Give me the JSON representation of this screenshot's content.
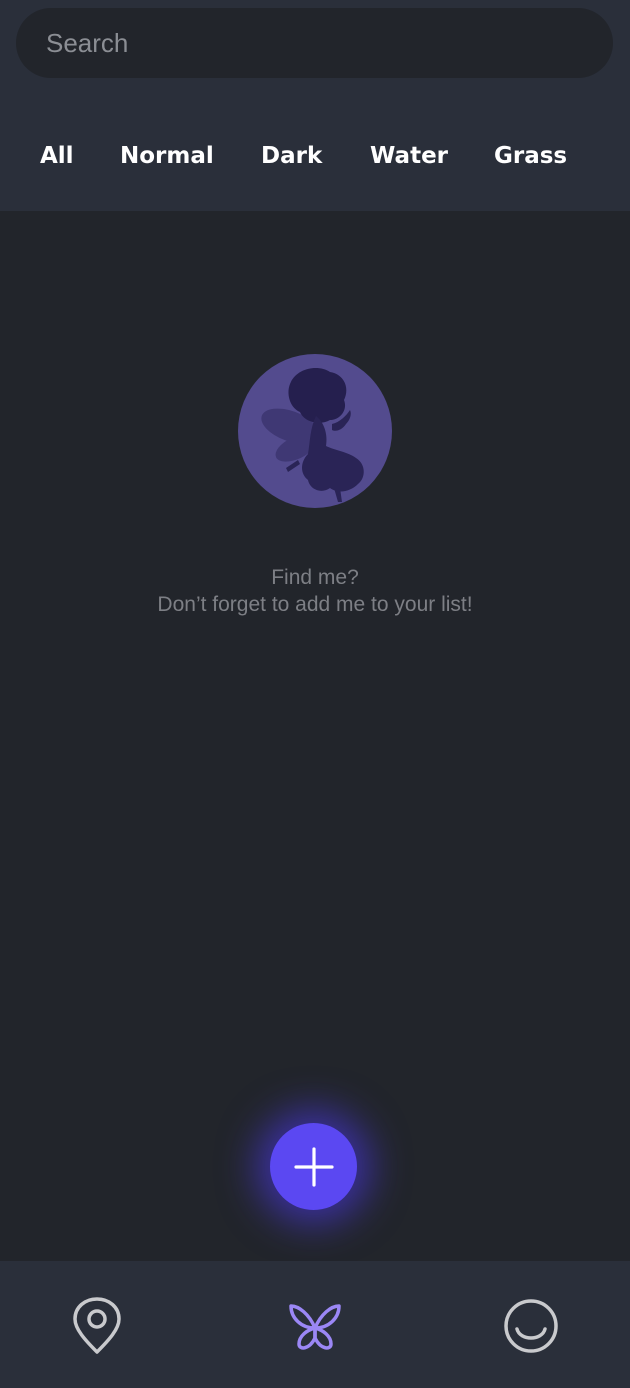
{
  "search": {
    "placeholder": "Search",
    "value": ""
  },
  "filters": {
    "tabs": [
      {
        "label": "All"
      },
      {
        "label": "Normal"
      },
      {
        "label": "Dark"
      },
      {
        "label": "Water"
      },
      {
        "label": "Grass"
      }
    ]
  },
  "empty_state": {
    "illustration_icon": "fairy-silhouette-icon",
    "line1": "Find me?",
    "line2": "Don’t forget to add me to your list!"
  },
  "fab": {
    "icon": "plus-icon"
  },
  "bottom_nav": {
    "items": [
      {
        "icon": "map-pin-icon",
        "active": false
      },
      {
        "icon": "butterfly-icon",
        "active": true
      },
      {
        "icon": "smile-icon",
        "active": false
      }
    ]
  },
  "colors": {
    "background": "#22252b",
    "panel": "#2a2f3a",
    "accent": "#5b48f2",
    "active_icon": "#9b87f5",
    "inactive_icon": "#c9cacd",
    "muted_text": "#7d7f85"
  }
}
